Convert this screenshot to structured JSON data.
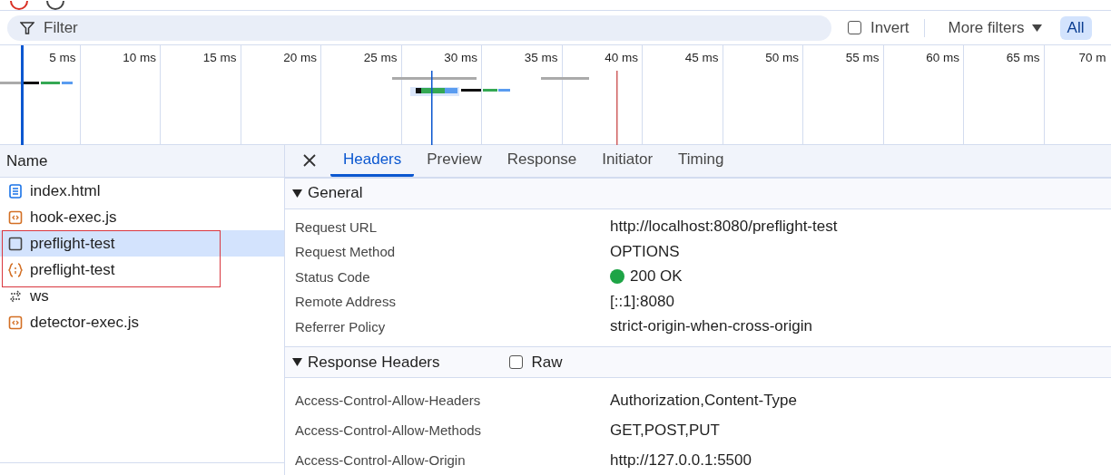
{
  "filter_bar": {
    "placeholder": "Filter",
    "invert": {
      "label": "Invert",
      "checked": false
    },
    "more_filters": "More filters",
    "type_buttons": [
      {
        "label": "All",
        "selected": true
      }
    ]
  },
  "timeline": {
    "ticks": [
      "5 ms",
      "10 ms",
      "15 ms",
      "20 ms",
      "25 ms",
      "30 ms",
      "35 ms",
      "40 ms",
      "45 ms",
      "50 ms",
      "55 ms",
      "60 ms",
      "65 ms",
      "70 m"
    ]
  },
  "requests": {
    "column": "Name",
    "rows": [
      {
        "name": "index.html",
        "kind": "document",
        "selected": false
      },
      {
        "name": "hook-exec.js",
        "kind": "script",
        "selected": false
      },
      {
        "name": "preflight-test",
        "kind": "preflight",
        "selected": true
      },
      {
        "name": "preflight-test",
        "kind": "fetch",
        "selected": false
      },
      {
        "name": "ws",
        "kind": "websocket",
        "selected": false
      },
      {
        "name": "detector-exec.js",
        "kind": "script",
        "selected": false
      }
    ]
  },
  "details": {
    "tabs": [
      {
        "label": "Headers",
        "selected": true
      },
      {
        "label": "Preview",
        "selected": false
      },
      {
        "label": "Response",
        "selected": false
      },
      {
        "label": "Initiator",
        "selected": false
      },
      {
        "label": "Timing",
        "selected": false
      }
    ],
    "sections": [
      {
        "title": "General",
        "expanded": true,
        "rows": [
          {
            "name": "Request URL",
            "value": "http://localhost:8080/preflight-test"
          },
          {
            "name": "Request Method",
            "value": "OPTIONS"
          },
          {
            "name": "Status Code",
            "value": "200 OK",
            "status_ok": true
          },
          {
            "name": "Remote Address",
            "value": "[::1]:8080"
          },
          {
            "name": "Referrer Policy",
            "value": "strict-origin-when-cross-origin"
          }
        ]
      },
      {
        "title": "Response Headers",
        "expanded": true,
        "raw": {
          "label": "Raw",
          "checked": false
        },
        "rows": [
          {
            "name": "Access-Control-Allow-Headers",
            "value": "Authorization,Content-Type"
          },
          {
            "name": "Access-Control-Allow-Methods",
            "value": "GET,POST,PUT"
          },
          {
            "name": "Access-Control-Allow-Origin",
            "value": "http://127.0.0.1:5500"
          }
        ]
      }
    ]
  }
}
